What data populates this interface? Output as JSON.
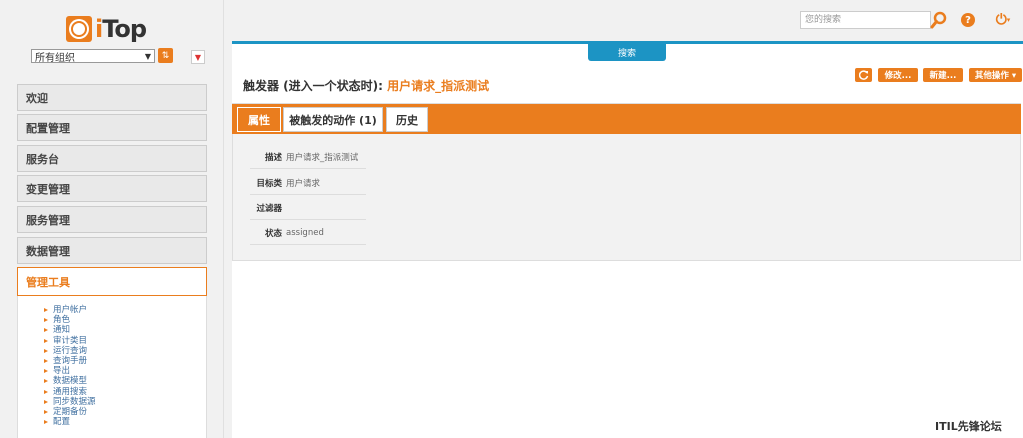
{
  "logo": {
    "text_i": "i",
    "text_rest": "Top"
  },
  "org_select": {
    "value": "所有组织"
  },
  "left_menu": [
    {
      "label": "欢迎"
    },
    {
      "label": "配置管理"
    },
    {
      "label": "服务台"
    },
    {
      "label": "变更管理"
    },
    {
      "label": "服务管理"
    },
    {
      "label": "数据管理"
    },
    {
      "label": "管理工具"
    }
  ],
  "admin_submenu": [
    "用户帐户",
    "角色",
    "通知",
    "审计类目",
    "运行查询",
    "查询手册",
    "导出",
    "数据模型",
    "通用搜索",
    "同步数据源",
    "定期备份",
    "配置"
  ],
  "search": {
    "placeholder": "您的搜索",
    "tab_label": "搜索"
  },
  "page": {
    "title_prefix": "触发器 (进入一个状态时): ",
    "object_name": "用户请求_指派测试"
  },
  "actions": {
    "modify": "修改...",
    "new": "新建...",
    "other": "其他操作 ▾"
  },
  "tabs": [
    {
      "label": "属性"
    },
    {
      "label": "被触发的动作 (1)"
    },
    {
      "label": "历史"
    }
  ],
  "fields": [
    {
      "label": "描述",
      "value": "用户请求_指派测试"
    },
    {
      "label": "目标类",
      "value": "用户请求"
    },
    {
      "label": "过滤器",
      "value": ""
    },
    {
      "label": "状态",
      "value": "assigned"
    }
  ],
  "watermark": "ITIL先锋论坛",
  "colors": {
    "accent": "#ea7d1e",
    "blue": "#1c94c4"
  },
  "icons": [
    "org-filter-icon",
    "pin-icon",
    "search-icon",
    "help-icon",
    "power-icon",
    "refresh-icon"
  ]
}
